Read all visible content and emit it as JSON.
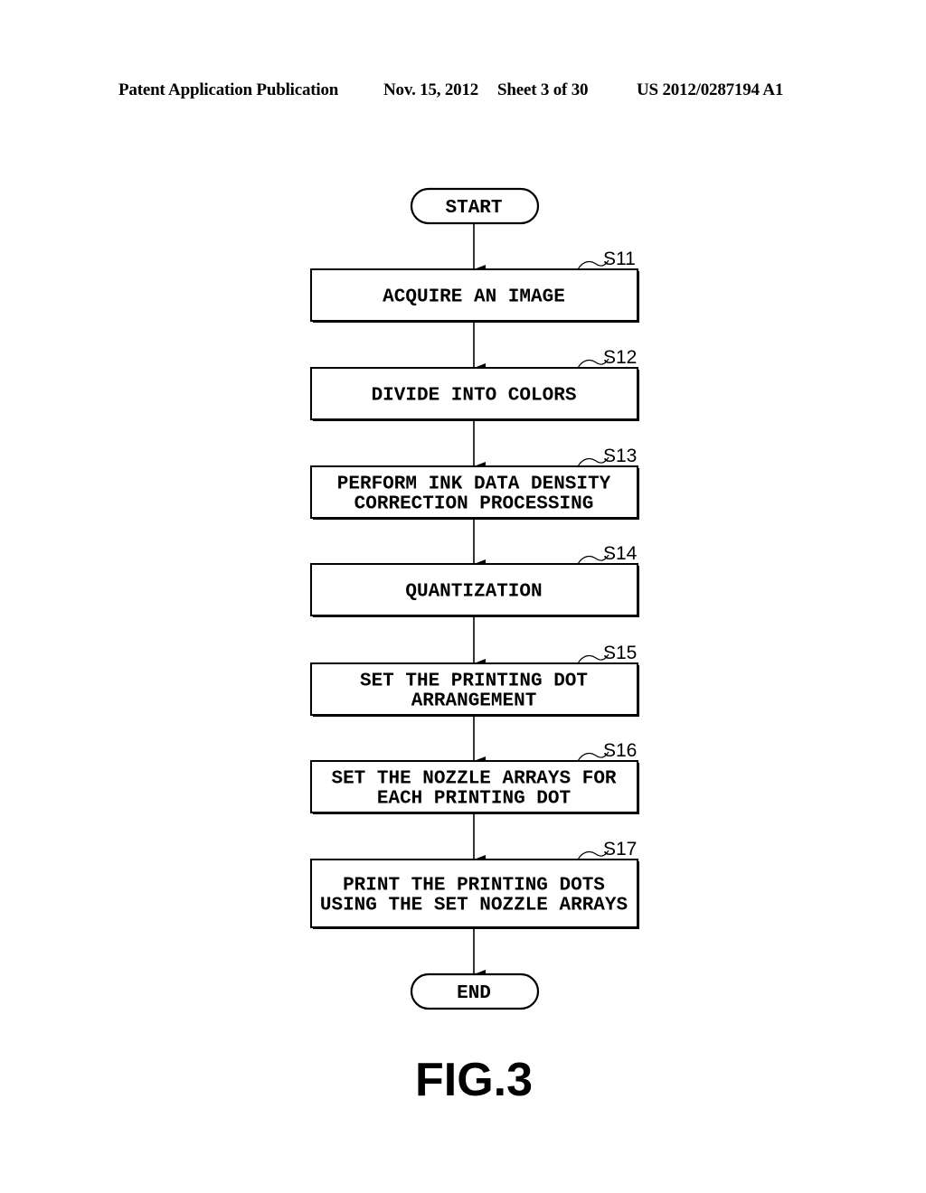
{
  "header": {
    "publication": "Patent Application Publication",
    "date": "Nov. 15, 2012",
    "sheet": "Sheet 3 of 30",
    "number": "US 2012/0287194 A1"
  },
  "flowchart": {
    "start": "START",
    "end": "END",
    "steps": [
      {
        "label": "S11",
        "lines": [
          "ACQUIRE AN IMAGE"
        ]
      },
      {
        "label": "S12",
        "lines": [
          "DIVIDE INTO COLORS"
        ]
      },
      {
        "label": "S13",
        "lines": [
          "PERFORM INK DATA DENSITY",
          "CORRECTION PROCESSING"
        ]
      },
      {
        "label": "S14",
        "lines": [
          "QUANTIZATION"
        ]
      },
      {
        "label": "S15",
        "lines": [
          "SET THE PRINTING DOT",
          "ARRANGEMENT"
        ]
      },
      {
        "label": "S16",
        "lines": [
          "SET THE NOZZLE ARRAYS FOR",
          "EACH PRINTING DOT"
        ]
      },
      {
        "label": "S17",
        "lines": [
          "PRINT THE PRINTING DOTS",
          "USING THE SET NOZZLE ARRAYS"
        ]
      }
    ]
  },
  "figure_label": "FIG.3"
}
